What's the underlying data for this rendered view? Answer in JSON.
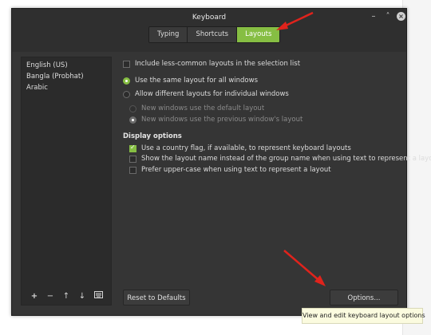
{
  "window": {
    "title": "Keyboard"
  },
  "tabs": [
    {
      "label": "Typing",
      "active": false
    },
    {
      "label": "Shortcuts",
      "active": false
    },
    {
      "label": "Layouts",
      "active": true
    }
  ],
  "layouts": [
    "English (US)",
    "Bangla (Probhat)",
    "Arabic"
  ],
  "options": {
    "less_common": {
      "label": "Include less-common layouts in the selection list",
      "checked": false
    },
    "same_layout": {
      "label": "Use the same layout for all windows",
      "selected": true
    },
    "different_layouts": {
      "label": "Allow different layouts for individual windows",
      "selected": false
    },
    "new_default": {
      "label": "New windows use the default layout",
      "selected": false,
      "disabled": true
    },
    "new_previous": {
      "label": "New windows use the previous window's layout",
      "selected": true,
      "disabled": true
    }
  },
  "display_options": {
    "heading": "Display options",
    "country_flag": {
      "label": "Use a country flag, if available,  to represent keyboard layouts",
      "checked": true
    },
    "show_layout_name": {
      "label": "Show the layout name instead of the group name when using text to represent a layout",
      "checked": false
    },
    "upper_case": {
      "label": "Prefer upper-case when using text to represent a layout",
      "checked": false
    }
  },
  "buttons": {
    "reset": "Reset to Defaults",
    "options": "Options..."
  },
  "tooltip": "View and edit keyboard layout options",
  "toolbar_icons": [
    "plus-icon",
    "minus-icon",
    "arrow-up-icon",
    "arrow-down-icon",
    "keyboard-preview-icon"
  ],
  "colors": {
    "accent": "#86be43",
    "annotation": "#e0231c",
    "window_bg": "#353535"
  }
}
